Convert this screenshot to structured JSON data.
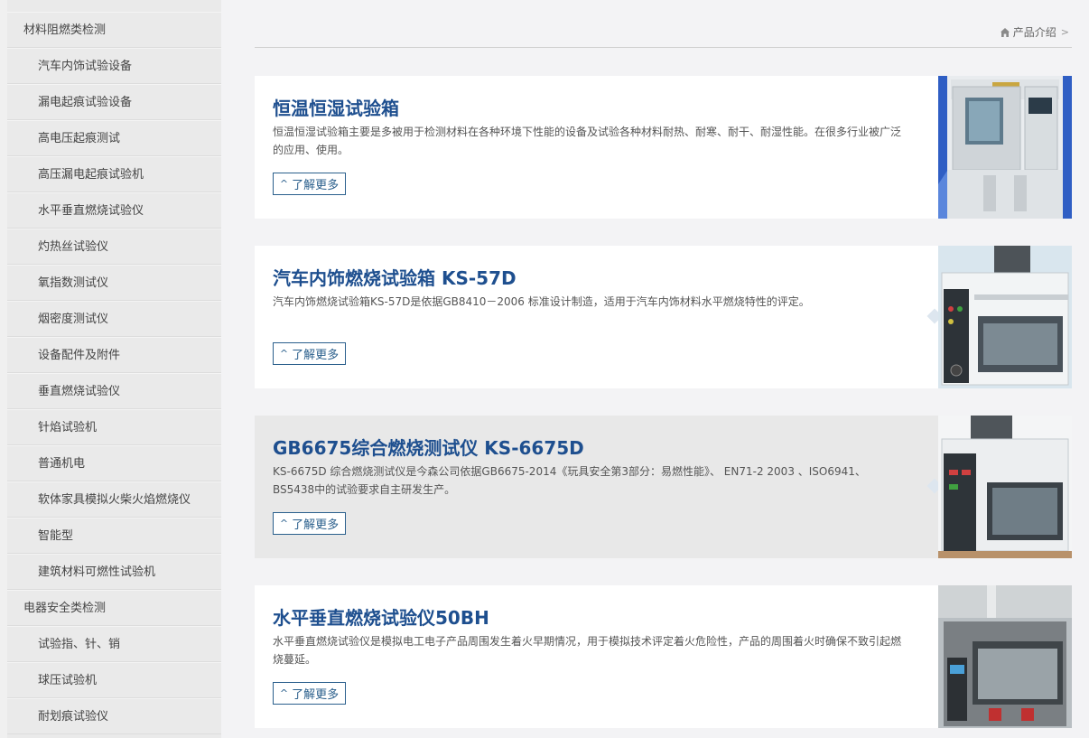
{
  "sidebar": {
    "items": [
      {
        "label": "材料阻燃类检测",
        "level": "category"
      },
      {
        "label": "汽车内饰试验设备",
        "level": "sub"
      },
      {
        "label": "漏电起痕试验设备",
        "level": "sub"
      },
      {
        "label": "高电压起痕测试",
        "level": "sub"
      },
      {
        "label": "高压漏电起痕试验机",
        "level": "sub"
      },
      {
        "label": "水平垂直燃烧试验仪",
        "level": "sub"
      },
      {
        "label": "灼热丝试验仪",
        "level": "sub"
      },
      {
        "label": "氧指数测试仪",
        "level": "sub"
      },
      {
        "label": "烟密度测试仪",
        "level": "sub"
      },
      {
        "label": "设备配件及附件",
        "level": "sub"
      },
      {
        "label": "垂直燃烧试验仪",
        "level": "sub"
      },
      {
        "label": "针焰试验机",
        "level": "sub"
      },
      {
        "label": "普通机电",
        "level": "sub"
      },
      {
        "label": "软体家具模拟火柴火焰燃烧仪",
        "level": "sub"
      },
      {
        "label": "智能型",
        "level": "sub"
      },
      {
        "label": "建筑材料可燃性试验机",
        "level": "sub"
      },
      {
        "label": "电器安全类检测",
        "level": "category"
      },
      {
        "label": "试验指、针、销",
        "level": "sub"
      },
      {
        "label": "球压试验机",
        "level": "sub"
      },
      {
        "label": "耐划痕试验仪",
        "level": "sub"
      }
    ]
  },
  "breadcrumb": {
    "label": "产品介绍",
    "separator": ">"
  },
  "products": [
    {
      "title": "恒温恒湿试验箱",
      "description": "恒温恒湿试验箱主要是多被用于检测材料在各种环境下性能的设备及试验各种材料耐热、耐寒、耐干、耐湿性能。在很多行业被广泛的应用、使用。",
      "button_label": "了解更多"
    },
    {
      "title": "汽车内饰燃烧试验箱 KS-57D",
      "description": "汽车内饰燃烧试验箱KS-57D是依据GB8410－2006 标准设计制造，适用于汽车内饰材料水平燃烧特性的评定。",
      "button_label": "了解更多"
    },
    {
      "title": "GB6675综合燃烧测试仪 KS-6675D",
      "description": "KS-6675D 综合燃烧测试仪是今森公司依据GB6675-2014《玩具安全第3部分：易燃性能》、 EN71-2 2003 、ISO6941、BS5438中的试验要求自主研发生产。",
      "button_label": "了解更多"
    },
    {
      "title": "水平垂直燃烧试验仪50BH",
      "description": "水平垂直燃烧试验仪是模拟电工电子产品周围发生着火早期情况，用于模拟技术评定着火危险性，产品的周围着火时确保不致引起燃烧蔓延。",
      "button_label": "了解更多"
    }
  ],
  "colors": {
    "title": "#1e4f8f",
    "button_border": "#2a5f8c",
    "sidebar_bg": "#eaeaea",
    "page_bg": "#f3f3f5"
  }
}
